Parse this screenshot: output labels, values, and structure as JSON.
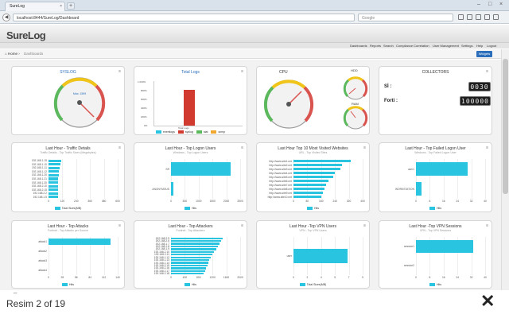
{
  "browser": {
    "tab_title": "SureLog",
    "url": "localhost:8444/SureLog/Dashboard",
    "search_placeholder": "Google"
  },
  "app": {
    "logo": "SureLog",
    "menu": [
      "Dashboards",
      "Reports",
      "Search",
      "Compliance",
      "Correlation",
      "User Management",
      "Settings",
      "Help",
      "Logout"
    ],
    "breadcrumb_home": "Home",
    "breadcrumb_current": "Dashboards",
    "widgets_button": "Widgets"
  },
  "colors": {
    "bar": "#29c5e0",
    "header_blue": "#2a6ebb",
    "gauge_green": "#5cb85c",
    "gauge_yellow": "#f0c419",
    "gauge_red": "#d9534f",
    "bar_red": "#d13a2f"
  },
  "panels": {
    "syslog": {
      "title": "SYSLOG",
      "label": "Max: 1599"
    },
    "total_logs": {
      "title": "Total Logs",
      "xlabel": "Total Logs",
      "legend": [
        "eventlogs",
        "syslog",
        "stat",
        "snmp"
      ],
      "ytick_labels": [
        "1.000%",
        "800%",
        "600%",
        "400%",
        "200%",
        "0%"
      ]
    },
    "cpu": {
      "title": "CPU",
      "hdd": "HDD",
      "ram": "RAM"
    },
    "collectors": {
      "title": "COLLECTORS",
      "rows": [
        {
          "label": "Sİ :",
          "value": "0030"
        },
        {
          "label": "Forti :",
          "value": "100000"
        }
      ]
    },
    "traffic": {
      "title": "Last Hour - Traffic Details",
      "subtitle": "Traffic Details - Top Traffic Sizes (Megabytes)",
      "legend": "Total Sizes(MB)"
    },
    "login_users": {
      "title": "Last Hour - Top Logon Users",
      "subtitle": "Windows - Top Logon Users",
      "legend": "Hits"
    },
    "websites": {
      "title": "Last Hour Top 10 Most Visited Websites",
      "subtitle": "URL - Top Visited Sites",
      "legend": "Hits"
    },
    "failed_login": {
      "title": "Last Hour - Top Failed Logon User",
      "subtitle": "Windows - Top Failed Logon User",
      "legend": "Hits"
    },
    "attacks": {
      "title": "Last Hour - Top Attacks",
      "subtitle": "Fortinet - Top Attacks per Source",
      "legend": "Hits"
    },
    "attackers": {
      "title": "Last Hour - Top Attackers",
      "subtitle": "Fortinet - Top Attackers",
      "legend": "Hits"
    },
    "vpn_users": {
      "title": "Last Hour -Top VPN Users",
      "subtitle": "VPN - Top VPN Users",
      "legend": "Total Sizes(MB)"
    },
    "vpn_sessions": {
      "title": "Last Hour -Top VPN Sessions",
      "subtitle": "VPN - Top VPN Sessions",
      "legend": "Hits"
    }
  },
  "chart_data": [
    {
      "type": "bar",
      "title": "Total Logs",
      "categories": [
        "eventlogs",
        "syslog",
        "stat",
        "snmp"
      ],
      "values": [
        0,
        800,
        0,
        0
      ],
      "ylim": [
        0,
        1000
      ]
    },
    {
      "type": "bar",
      "title": "Last Hour - Traffic Details",
      "categories": [
        "192.168.1.15",
        "192.168.1.10",
        "192.168.1.11",
        "192.168.1.12",
        "192.168.1.20",
        "192.168.1.21",
        "192.168.1.30",
        "192.168.2.10",
        "192.168.2.15",
        "192.168.2.2",
        "192.168.1.5"
      ],
      "values": [
        110,
        105,
        95,
        90,
        88,
        86,
        85,
        84,
        83,
        82,
        80
      ],
      "xlim": [
        0,
        600
      ]
    },
    {
      "type": "bar",
      "title": "Last Hour - Top Logon Users",
      "categories": [
        "SR",
        "ANONYMOUS"
      ],
      "values": [
        2150,
        100
      ],
      "xlim": [
        0,
        2500
      ]
    },
    {
      "type": "bar",
      "title": "Last Hour Top 10 Most Visited Websites",
      "categories": [
        "http://www.site1.net",
        "http://www.site2.net",
        "http://www.site3.net",
        "http://www.site4.net",
        "http://www.site5.net",
        "http://www.site6.net",
        "http://www.site7.net",
        "http://www.site8.net",
        "http://www.site9.net",
        "http://www.site10.net"
      ],
      "values": [
        330,
        280,
        270,
        240,
        230,
        200,
        190,
        180,
        170,
        160
      ],
      "xlim": [
        0,
        400
      ]
    },
    {
      "type": "bar",
      "title": "Last Hour - Top Failed Logon User",
      "categories": [
        "user1",
        "WORKSTATION"
      ],
      "values": [
        30,
        3
      ],
      "xlim": [
        0,
        40
      ]
    },
    {
      "type": "bar",
      "title": "Last Hour - Top Attacks",
      "categories": [
        "attack1",
        "attack2",
        "attack3",
        "attack4"
      ],
      "values": [
        125,
        0,
        0,
        0
      ],
      "xlim": [
        0,
        140
      ]
    },
    {
      "type": "bar",
      "title": "Last Hour - Top Attackers",
      "categories": [
        "192.168.2.5",
        "192.168.2.6",
        "192.168.1.7",
        "192.168.1.8",
        "192.168.1.9",
        "192.168.2.10",
        "192.168.2.11",
        "192.168.1.12",
        "192.168.1.13",
        "192.168.1.14",
        "192.168.2.15",
        "192.168.2.16",
        "192.168.2.17",
        "192.168.2.18"
      ],
      "values": [
        1500,
        1450,
        1400,
        1350,
        1300,
        1250,
        1200,
        1150,
        1100,
        1080,
        1050,
        1000,
        980,
        950
      ],
      "xlim": [
        0,
        2000
      ]
    },
    {
      "type": "bar",
      "title": "Last Hour -Top VPN Users",
      "categories": [
        "user"
      ],
      "values": [
        7
      ],
      "xlim": [
        0,
        9
      ]
    },
    {
      "type": "bar",
      "title": "Last Hour -Top VPN Sessions",
      "categories": [
        "session1",
        "session2"
      ],
      "values": [
        33,
        0
      ],
      "xlim": [
        0,
        40
      ]
    }
  ],
  "footer": {
    "caption": "Resim 2 of 19",
    "dash": "–"
  }
}
